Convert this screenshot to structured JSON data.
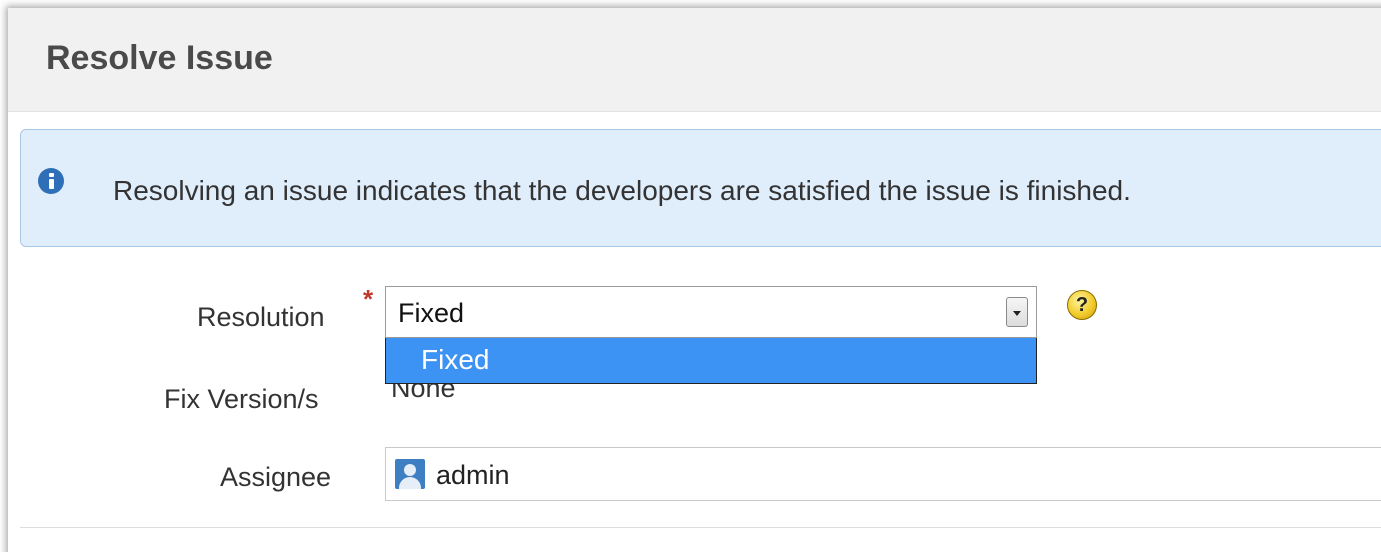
{
  "dialog": {
    "title": "Resolve Issue"
  },
  "info": {
    "icon": "info-icon",
    "message": "Resolving an issue indicates that the developers are satisfied the issue is finished."
  },
  "form": {
    "resolution": {
      "label": "Resolution",
      "required_marker": "*",
      "selected": "Fixed",
      "options": [
        "Fixed"
      ],
      "highlighted_option": "Fixed",
      "help_icon": "?"
    },
    "fix_version": {
      "label": "Fix Version/s",
      "value": "None"
    },
    "assignee": {
      "label": "Assignee",
      "value": "admin",
      "icon": "user-avatar-icon"
    }
  },
  "colors": {
    "header_bg": "#f1f1f1",
    "info_bg": "#e0edfb",
    "info_border": "#a8c8e8",
    "info_icon": "#2f6fb8",
    "dropdown_highlight": "#3c93f4",
    "required": "#c0392b",
    "help_icon": "#f2cc2b"
  }
}
